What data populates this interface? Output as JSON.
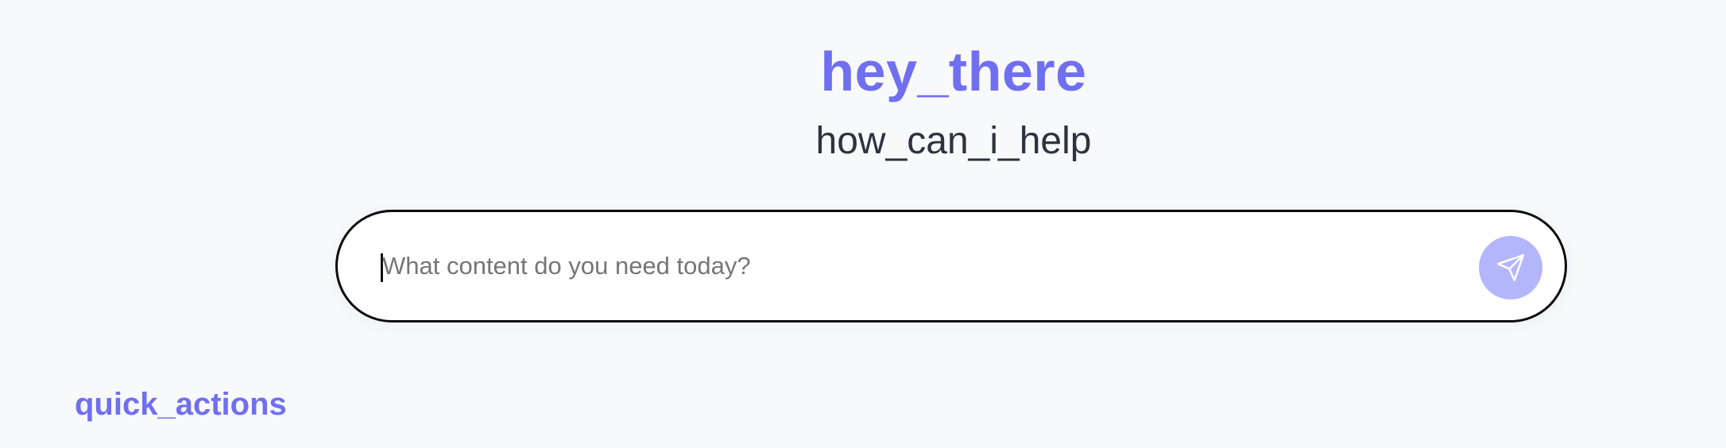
{
  "header": {
    "greeting": "hey_there",
    "subtitle": "how_can_i_help"
  },
  "prompt": {
    "value": "",
    "placeholder": "What content do you need today?",
    "send_icon": "send-icon"
  },
  "sections": {
    "quick_actions_title": "quick_actions"
  },
  "colors": {
    "accent": "#6f6ff0",
    "send_button": "#b3b6fb",
    "background": "#f8f9fb",
    "subtitle_text": "#2e3340"
  }
}
